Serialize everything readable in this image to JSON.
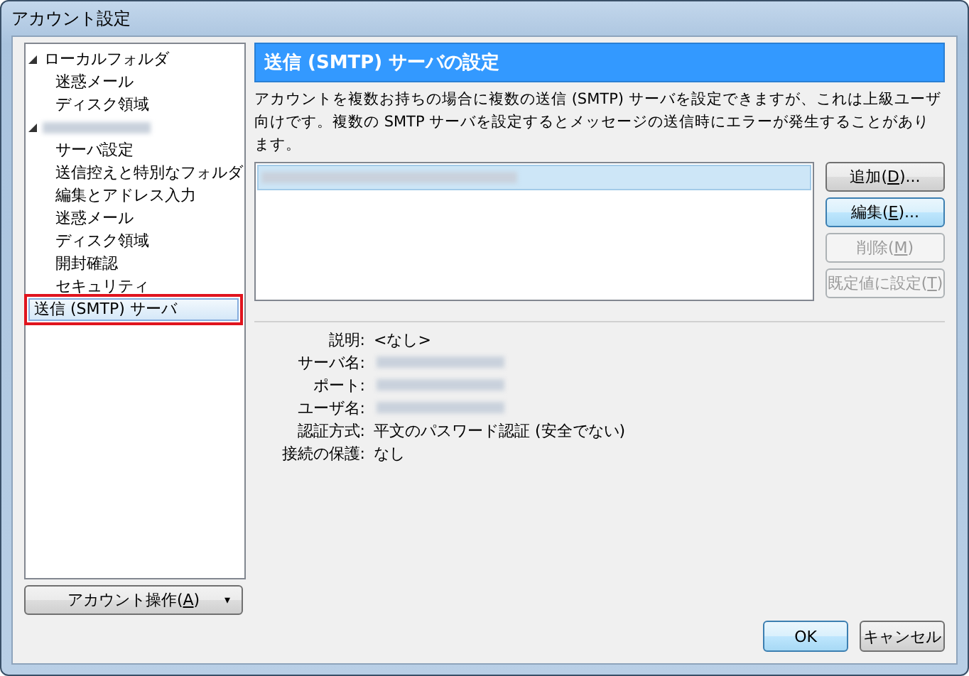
{
  "window": {
    "title": "アカウント設定"
  },
  "tree": [
    {
      "label": "ローカルフォルダ",
      "kind": "text",
      "expanded": true,
      "selected": false,
      "children": [
        {
          "label": "迷惑メール",
          "kind": "text",
          "selected": false
        },
        {
          "label": "ディスク領域",
          "kind": "text",
          "selected": false
        }
      ]
    },
    {
      "kind": "redacted",
      "expanded": true,
      "selected": false,
      "children": [
        {
          "label": "サーバ設定",
          "kind": "text",
          "selected": false
        },
        {
          "label": "送信控えと特別なフォルダ",
          "kind": "text",
          "selected": false
        },
        {
          "label": "編集とアドレス入力",
          "kind": "text",
          "selected": false
        },
        {
          "label": "迷惑メール",
          "kind": "text",
          "selected": false
        },
        {
          "label": "ディスク領域",
          "kind": "text",
          "selected": false
        },
        {
          "label": "開封確認",
          "kind": "text",
          "selected": false
        },
        {
          "label": "セキュリティ",
          "kind": "text",
          "selected": false
        }
      ]
    },
    {
      "label": "送信 (SMTP) サーバ",
      "kind": "text",
      "selected": true,
      "highlighted": true
    }
  ],
  "account_button": {
    "before": "アカウント操作(",
    "key": "A",
    "after": ")",
    "caret": "▾"
  },
  "panel": {
    "title": "送信 (SMTP) サーバの設定",
    "description": "アカウントを複数お持ちの場合に複数の送信 (SMTP) サーバを設定できますが、これは上級ユーザ向けです。複数の SMTP サーバを設定するとメッセージの送信時にエラーが発生することがあります。",
    "servers": [
      {
        "kind": "redacted",
        "selected": true
      }
    ],
    "buttons": [
      {
        "before": "追加(",
        "key": "D",
        "after": ")...",
        "disabled": false,
        "focused": false
      },
      {
        "before": "編集(",
        "key": "E",
        "after": ")...",
        "disabled": false,
        "focused": true
      },
      {
        "before": "削除(",
        "key": "M",
        "after": ")",
        "disabled": true,
        "focused": false
      },
      {
        "before": "既定値に設定(",
        "key": "T",
        "after": ")",
        "disabled": true,
        "focused": false
      }
    ],
    "details": [
      {
        "label": "説明:",
        "kind": "text",
        "value": "<なし>"
      },
      {
        "label": "サーバ名:",
        "kind": "redacted"
      },
      {
        "label": "ポート:",
        "kind": "redacted"
      },
      {
        "label": "ユーザ名:",
        "kind": "redacted"
      },
      {
        "label": "認証方式:",
        "kind": "text",
        "value": "平文のパスワード認証 (安全でない)"
      },
      {
        "label": "接続の保護:",
        "kind": "text",
        "value": "なし"
      }
    ]
  },
  "dialog_buttons": [
    {
      "label": "OK",
      "focused": true
    },
    {
      "label": "キャンセル",
      "focused": false
    }
  ]
}
